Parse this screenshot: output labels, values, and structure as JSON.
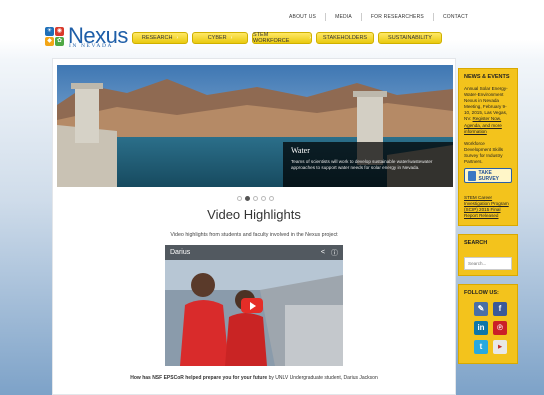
{
  "top_nav": [
    "ABOUT US",
    "MEDIA",
    "FOR RESEARCHERS",
    "CONTACT"
  ],
  "logo": {
    "word": "Nexus",
    "subtitle": "IN NEVADA"
  },
  "main_nav": [
    {
      "label": "RESEARCH",
      "dropdown": true
    },
    {
      "label": "CYBER",
      "dropdown": true
    },
    {
      "label": "STEM WORKFORCE",
      "dropdown": true
    },
    {
      "label": "STAKEHOLDERS",
      "dropdown": false
    },
    {
      "label": "SUSTAINABILITY",
      "dropdown": false
    }
  ],
  "hero": {
    "title": "Water",
    "text": "Teams of scientists will work to develop sustainable water/wastewater approaches to support water needs for solar energy in Nevada."
  },
  "slider": {
    "count": 5,
    "active": 1
  },
  "video_section": {
    "title": "Video Highlights",
    "subtitle": "Video highlights from students and faculty involved in the Nexus project",
    "video_title": "Darius"
  },
  "question": {
    "bold": "How has NSF EPSCoR helped prepare you for your future",
    "rest": " by UNLV Undergraduate student, Darius Jackson"
  },
  "sidebar": {
    "news_heading": "NEWS & EVENTS",
    "news_1": "Annual Solar Energy-Water-Environment Nexus in Nevada Meeting, February 9-10, 2015, Las Vegas, NV.",
    "news_1_link": "Register Now, Agenda, and more information",
    "news_2": "Workforce Development Skills Survey for Industry Partners.",
    "survey_button": "TAKE SURVEY",
    "news_3_link": "STEM Career Investigation Program (SCIP) 2015 Final Report Released",
    "search_heading": "SEARCH",
    "search_placeholder": "Search...",
    "follow_heading": "FOLLOW US:"
  },
  "colors": {
    "accent_yellow": "#f3c31c",
    "brand_blue": "#1e5ea8"
  }
}
